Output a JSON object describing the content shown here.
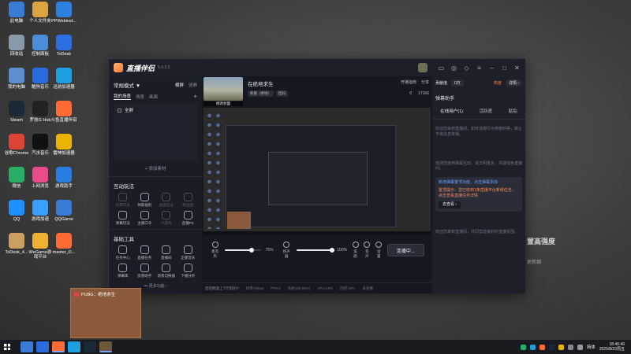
{
  "desktop_icons": [
    {
      "label": "此电脑",
      "icon": "computer-icon",
      "color": "#3a7bd5"
    },
    {
      "label": "个人文件夹",
      "icon": "folder-icon",
      "color": "#d9a441"
    },
    {
      "label": "PPWebinst...",
      "icon": "ppweb-icon",
      "color": "#2d7fe0"
    },
    {
      "label": "回收站",
      "icon": "recycle-bin-icon",
      "color": "#8899aa"
    },
    {
      "label": "控制面板",
      "icon": "control-panel-icon",
      "color": "#4a8ed8"
    },
    {
      "label": "ToDesk",
      "icon": "todesk-icon",
      "color": "#2d6fe0"
    },
    {
      "label": "我的电脑",
      "icon": "computer2-icon",
      "color": "#5b8fd0"
    },
    {
      "label": "酷狗音乐",
      "icon": "kugou-icon",
      "color": "#2a6be0"
    },
    {
      "label": "迅游加速器",
      "icon": "xunyou-icon",
      "color": "#1ea0e0"
    },
    {
      "label": "Steam",
      "icon": "steam-icon",
      "color": "#1b2838"
    },
    {
      "label": "罗技G Hub",
      "icon": "ghub-icon",
      "color": "#222222"
    },
    {
      "label": "斗鱼直播伴侣",
      "icon": "douyu-icon",
      "color": "#ff6b35"
    },
    {
      "label": "谷歌Chrome",
      "icon": "chrome-icon",
      "color": "#db4437"
    },
    {
      "label": "汽水音乐",
      "icon": "qishui-icon",
      "color": "#111111"
    },
    {
      "label": "雷神加速器",
      "icon": "leishen-icon",
      "color": "#e8b400"
    },
    {
      "label": "微信",
      "icon": "wechat-icon",
      "color": "#2aae67"
    },
    {
      "label": "上网浏览",
      "icon": "browser-icon",
      "color": "#e84b8a"
    },
    {
      "label": "游戏助手",
      "icon": "game-helper-icon",
      "color": "#2a7de0"
    },
    {
      "label": "QQ",
      "icon": "qq-icon",
      "color": "#1e90ff"
    },
    {
      "label": "游戏加速",
      "icon": "cloud-icon",
      "color": "#3aa0ff"
    },
    {
      "label": "QQGame",
      "icon": "qqgame-icon",
      "color": "#3a7bd5"
    },
    {
      "label": "ToDesk_4...",
      "icon": "package-icon",
      "color": "#c9a060"
    },
    {
      "label": "WeGame游戏平台",
      "icon": "wegame-icon",
      "color": "#f0b030"
    },
    {
      "label": "master_D...",
      "icon": "master-icon",
      "color": "#ff6b35"
    }
  ],
  "app": {
    "title": "直播伴侣",
    "version": "5.4.3.2"
  },
  "left": {
    "mode": "常规模式 ▼",
    "mode_tabs": [
      "横屏",
      "竖屏"
    ],
    "scene_tabs": [
      "我的场景",
      "场景",
      "画面"
    ],
    "scenes": [
      "全屏"
    ],
    "add_source": "+ 添加素材",
    "interact_title": "互动玩法",
    "interact_tools": [
      {
        "label": "投票玩法",
        "dim": true
      },
      {
        "label": "领取福利",
        "dim": false
      },
      {
        "label": "福袋玩法",
        "dim": true
      },
      {
        "label": "粉丝团",
        "dim": true
      },
      {
        "label": "弹幕玩法",
        "dim": false
      },
      {
        "label": "主播口令",
        "dim": false
      },
      {
        "label": "小游戏",
        "dim": true
      },
      {
        "label": "直播PK",
        "dim": false
      }
    ],
    "basic_title": "基础工具",
    "basic_tools": [
      {
        "label": "任务中心",
        "dim": false
      },
      {
        "label": "直播任务",
        "dim": false
      },
      {
        "label": "直播间",
        "dim": false
      },
      {
        "label": "正版音乐",
        "dim": false
      },
      {
        "label": "弹幕库",
        "dim": false
      },
      {
        "label": "房管助手",
        "dim": false
      },
      {
        "label": "场景切换器",
        "dim": false
      },
      {
        "label": "下播分析",
        "dim": false
      }
    ],
    "more": "••• 更多功能 ›"
  },
  "center": {
    "cover_label": "修改封面",
    "title": "在绝地求生",
    "tags": [
      "新服（绝地）",
      "回归"
    ],
    "open_guide": "开播指南",
    "share": "分享",
    "likes": "0",
    "viewers": "17166",
    "controls": {
      "mic_label": "麦克风",
      "mic_pct": "75%",
      "mic_level": 75,
      "speaker_label": "扬声器",
      "speaker_pct": "100%",
      "speaker_level": 100,
      "beauty": "美颜",
      "voice": "变声",
      "settings": "设置",
      "live_button": "连播中..."
    },
    "status": {
      "warn": "您的网速上下行较好?",
      "bitrate": "码率:0kbps",
      "fps": "FPS:0",
      "drop": "丢帧:0(0.00%)",
      "cpu": "CPU:15%",
      "mem": "内存:22%",
      "net": "未开播"
    }
  },
  "right": {
    "contrib": "贡献值",
    "count": "0万",
    "hot": "热度",
    "detail": "详情 ›",
    "danmu_title": "弹幕助手",
    "tabs": [
      "在线用户(1)",
      "活跃度",
      "贴贴"
    ],
    "msgs": [
      "欢迎您来到直播间，如有违规行为将被封禁，禁止不良信息传播。",
      "欢迎您使用弹幕互动，请文明发言，共建绿色直播间。"
    ],
    "notice_lines": [
      "新增弹幕置顶功能，点击弹幕添加",
      "置顶提示：您已收到1条直播平台新增任务，点击查看直播任务详情"
    ],
    "notice_link": "去查看 ›",
    "footer_msg": "欢迎您来到直播间，共同营造良好的直播氛围。"
  },
  "bg_right_text": [
    "置高强度",
    "更新细",
    "ZH"
  ],
  "popup": {
    "title": "PUBG：绝地求生"
  },
  "taskbar": {
    "lang": "简体",
    "time": "18:46:46",
    "date": "2025/8/22周五"
  }
}
